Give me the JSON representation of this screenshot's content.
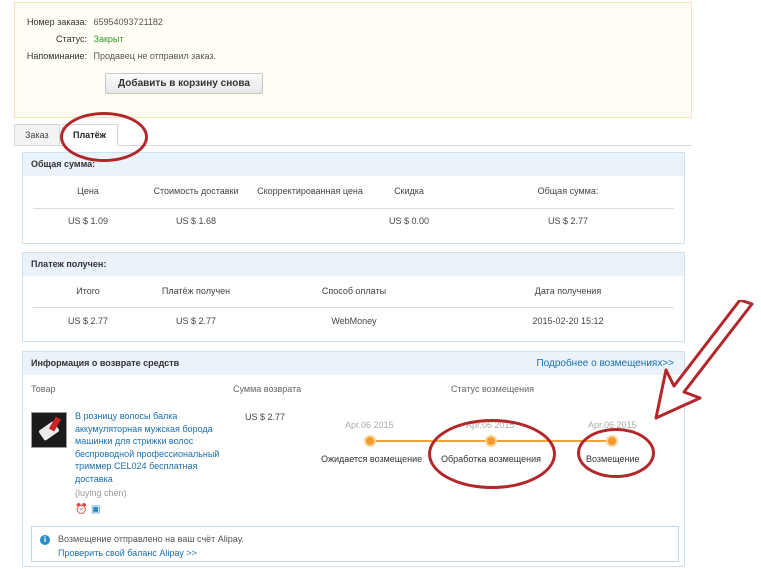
{
  "order": {
    "number_label": "Номер заказа:",
    "number_value": "65954093721182",
    "status_label": "Статус:",
    "status_value": "Закрыт",
    "reminder_label": "Напоминание:",
    "reminder_value": "Продавец не отправил заказ.",
    "readd_button": "Добавить в корзину снова"
  },
  "tabs": [
    "Заказ",
    "Платёж"
  ],
  "total_panel": {
    "title": "Общая сумма:",
    "headers": [
      "Цена",
      "Стоимость доставки",
      "Скорректированная цена",
      "Скидка",
      "Общая сумма:"
    ],
    "values": [
      "US $ 1.09",
      "US $ 1.68",
      "",
      "US $ 0.00",
      "US $ 2.77"
    ]
  },
  "payment_panel": {
    "title": "Платеж получен:",
    "headers": [
      "Итого",
      "Платёж получен",
      "Способ оплаты",
      "Дата получения"
    ],
    "values": [
      "US $ 2.77",
      "US $ 2.77",
      "WebMoney",
      "2015-02-20 15:12"
    ]
  },
  "refund_panel": {
    "title": "Информация о возврате средств",
    "more_link": "Подробнее о возмещениях>>",
    "col_product": "Товар",
    "col_amount": "Сумма возврата",
    "col_status": "Статус возмещения",
    "product_title": "В розницу волосы балка аккумуляторная мужская борода машинки для стрижки волос беспроводной профессиональный триммер CEL024 бесплатная доставка",
    "seller": "(luying chen)",
    "amount": "US $ 2.77",
    "steps": [
      {
        "date": "Apr.06 2015",
        "label": "Ожидается возмещение"
      },
      {
        "date": "Apr.06 2015",
        "label": "Обработка возмещения"
      },
      {
        "date": "Apr.06 2015",
        "label": "Возмещение"
      }
    ],
    "notice_message": "Возмещение отправлено на ваш счёт Alipay.",
    "notice_link": "Проверить свой баланс Alipay >>"
  },
  "colors": {
    "accent_link": "#1a6fb0",
    "status_green": "#2e9a2e",
    "progress_orange": "#f39a2a",
    "annotation_red": "#b3262a"
  }
}
